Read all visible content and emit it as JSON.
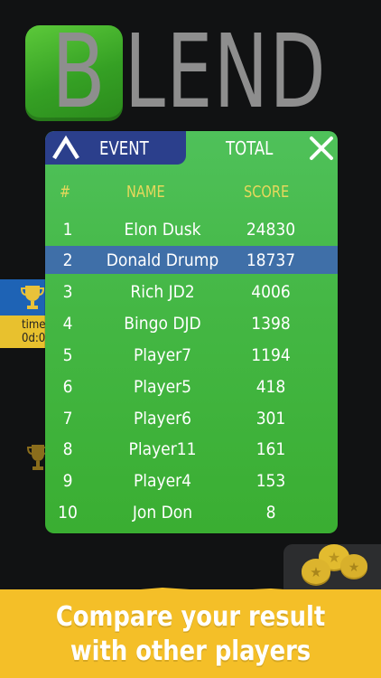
{
  "logo": {
    "first_letter": "B",
    "rest": "LEND"
  },
  "background": {
    "card_time_label": "time",
    "card_time_value": "0d:0"
  },
  "leaderboard": {
    "tabs": {
      "event": "EVENT",
      "total": "TOTAL"
    },
    "active_tab": "total",
    "headers": {
      "rank": "#",
      "name": "NAME",
      "score": "SCORE"
    },
    "highlighted_rank": 2,
    "rows": [
      {
        "rank": "1",
        "name": "Elon Dusk",
        "score": "24830"
      },
      {
        "rank": "2",
        "name": "Donald Drump",
        "score": "18737"
      },
      {
        "rank": "3",
        "name": "Rich JD2",
        "score": "4006"
      },
      {
        "rank": "4",
        "name": "Bingo DJD",
        "score": "1398"
      },
      {
        "rank": "5",
        "name": "Player7",
        "score": "1194"
      },
      {
        "rank": "6",
        "name": "Player5",
        "score": "418"
      },
      {
        "rank": "7",
        "name": "Player6",
        "score": "301"
      },
      {
        "rank": "8",
        "name": "Player11",
        "score": "161"
      },
      {
        "rank": "9",
        "name": "Player4",
        "score": "153"
      },
      {
        "rank": "10",
        "name": "Jon Don",
        "score": "8"
      }
    ]
  },
  "banner": {
    "line1": "Compare your result",
    "line2": "with other players"
  },
  "colors": {
    "panel_green": "#44b744",
    "event_tab": "#2b3f8c",
    "highlight_row": "#3f6fa8",
    "header_gold": "#e7d85c",
    "banner_yellow": "#f4bf28",
    "logo_green": "#35a024",
    "logo_gray": "#8e8e8e"
  },
  "icons": [
    "up-chevron-icon",
    "close-icon",
    "trophy-icon",
    "coins-icon"
  ]
}
